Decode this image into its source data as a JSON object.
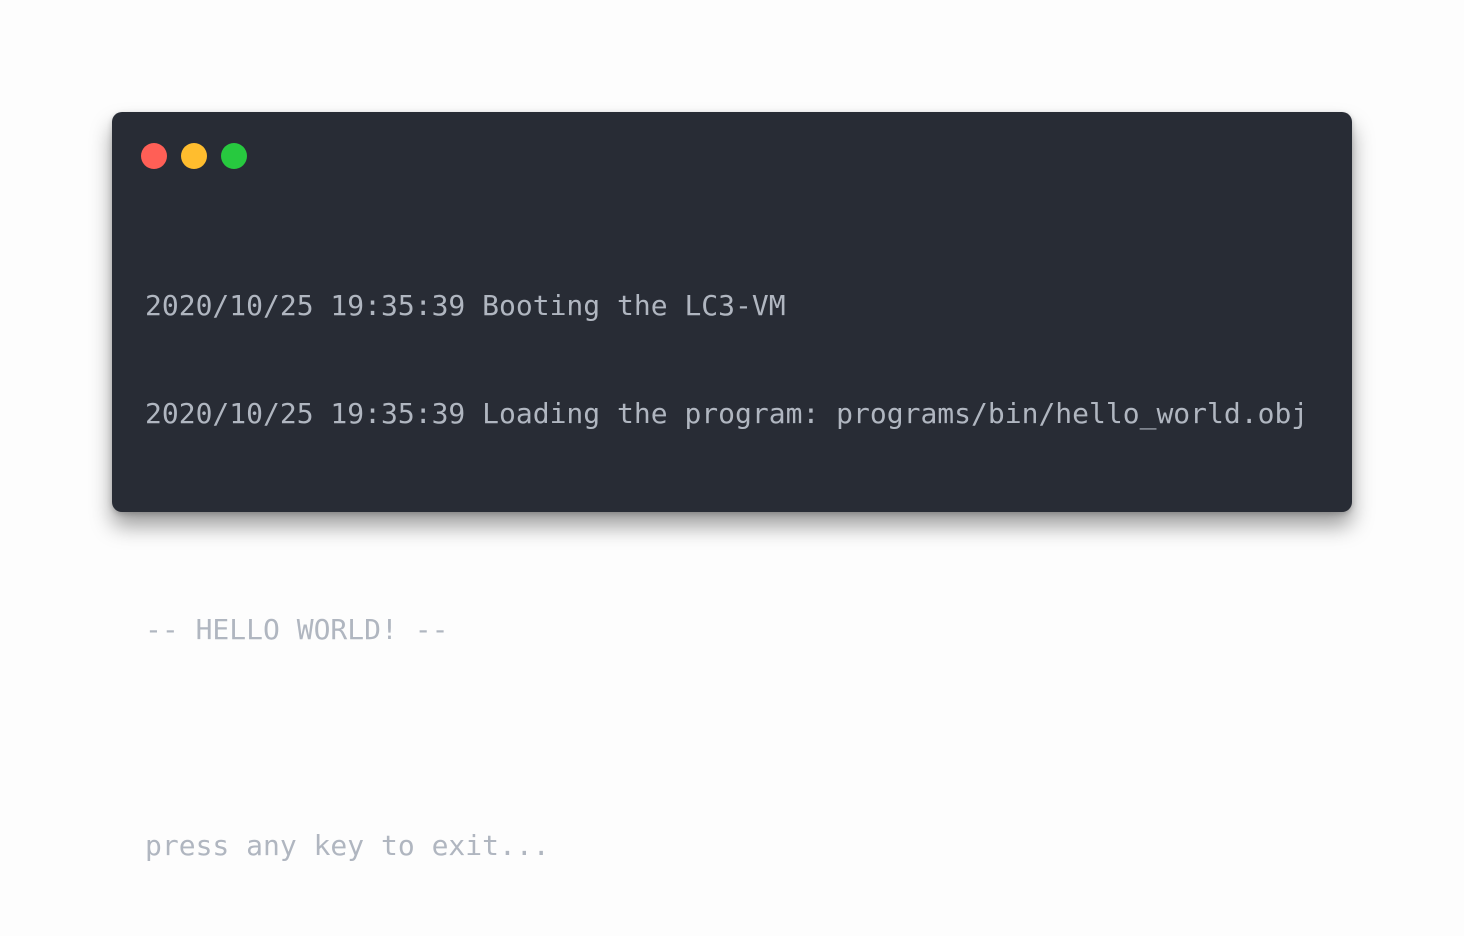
{
  "window": {
    "controls": [
      {
        "name": "close",
        "color": "#ff5f56"
      },
      {
        "name": "minimize",
        "color": "#ffbd2e"
      },
      {
        "name": "maximize",
        "color": "#27c93f"
      }
    ]
  },
  "terminal": {
    "background": "#282c35",
    "text_color": "#b0b6c0",
    "lines": [
      "2020/10/25 19:35:39 Booting the LC3-VM",
      "2020/10/25 19:35:39 Loading the program: programs/bin/hello_world.obj",
      "",
      "-- HELLO WORLD! --",
      "",
      "press any key to exit..."
    ]
  }
}
